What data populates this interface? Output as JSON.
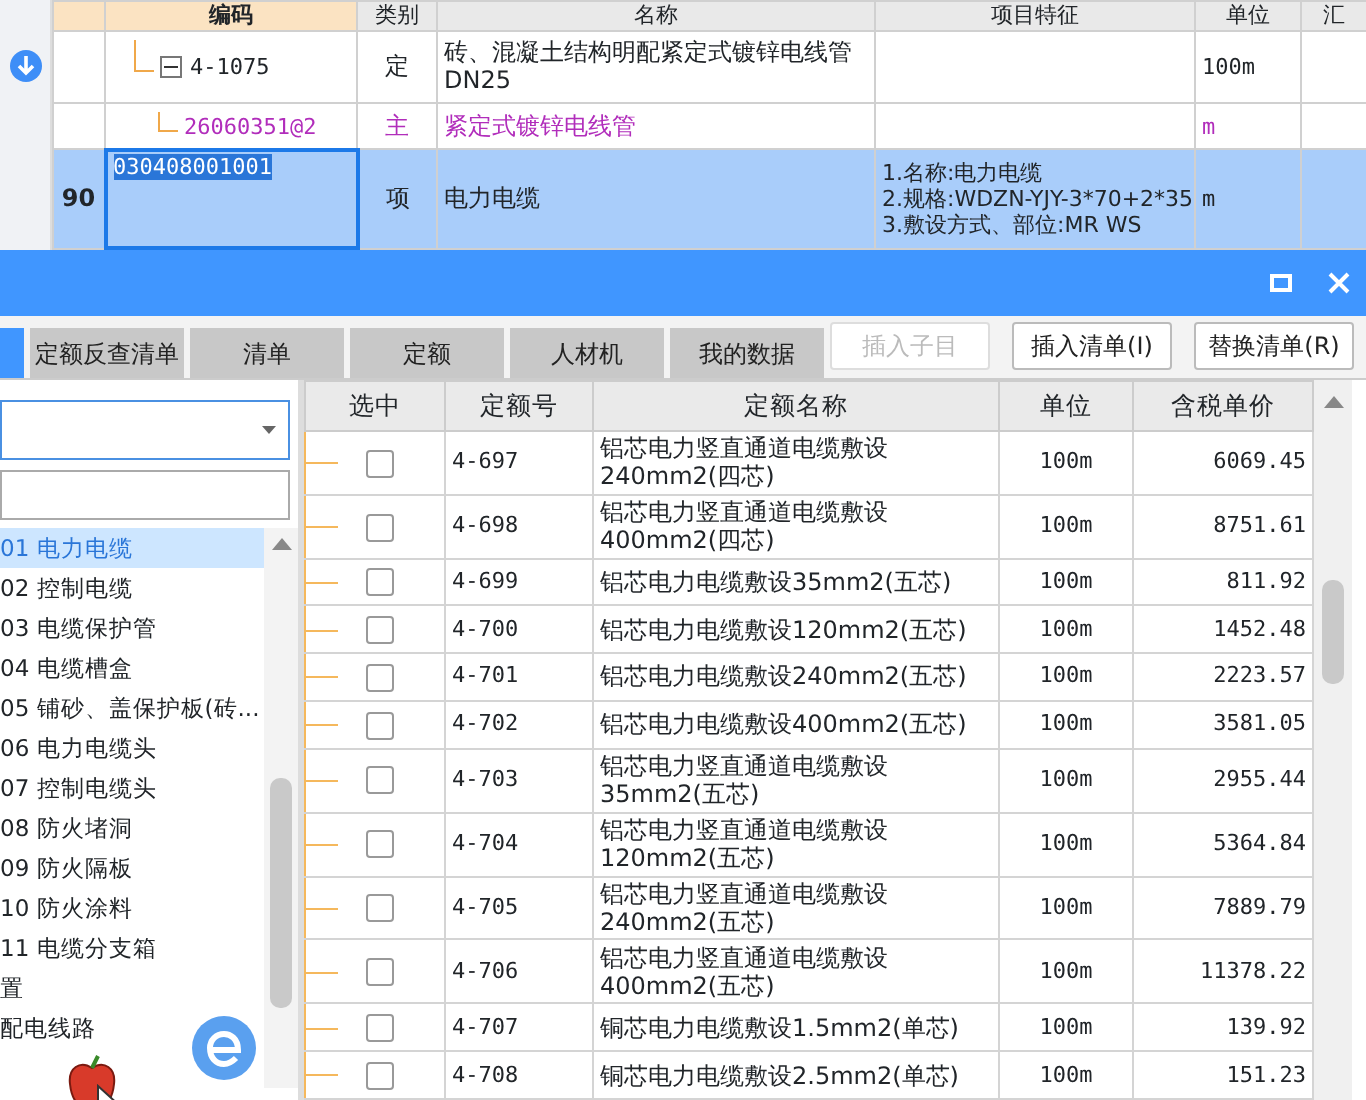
{
  "grid": {
    "columns": [
      "编码",
      "类别",
      "名称",
      "项目特征",
      "单位",
      "汇"
    ],
    "rows": [
      {
        "kind": "quota",
        "code": "4-1075",
        "expanded": true,
        "type": "定",
        "name": "砖、混凝土结构明配紧定式镀锌电线管DN25",
        "unit": "100m",
        "selected": false
      },
      {
        "kind": "material",
        "code": "26060351@2",
        "type": "主",
        "name": "紧定式镀锌电线管",
        "unit": "m",
        "selected": false
      },
      {
        "kind": "item",
        "number": "90",
        "code": "030408001001",
        "type": "项",
        "name": "电力电缆",
        "features": [
          "1.名称:电力电缆",
          "2.规格:WDZN-YJY-3*70+2*35",
          "3.敷设方式、部位:MR WS"
        ],
        "unit": "m",
        "selected": true
      }
    ]
  },
  "dialog": {
    "offscreen_tab": {
      "selected": true
    },
    "tabs": [
      {
        "label": "定额反查清单",
        "selected": false
      },
      {
        "label": "清单",
        "selected": false
      },
      {
        "label": "定额",
        "selected": false
      },
      {
        "label": "人材机",
        "selected": false
      },
      {
        "label": "我的数据",
        "selected": false
      }
    ],
    "buttons": [
      {
        "label": "插入子目",
        "disabled": true
      },
      {
        "label": "插入清单(I)",
        "disabled": false
      },
      {
        "label": "替换清单(R)",
        "disabled": false
      }
    ],
    "chapters": [
      {
        "code": "01",
        "name": "电力电缆",
        "selected": true
      },
      {
        "code": "02",
        "name": "控制电缆",
        "selected": false
      },
      {
        "code": "03",
        "name": "电缆保护管",
        "selected": false
      },
      {
        "code": "04",
        "name": "电缆槽盒",
        "selected": false
      },
      {
        "code": "05",
        "name": "铺砂、盖保护板(砖...",
        "selected": false
      },
      {
        "code": "06",
        "name": "电力电缆头",
        "selected": false
      },
      {
        "code": "07",
        "name": "控制电缆头",
        "selected": false
      },
      {
        "code": "08",
        "name": "防火堵洞",
        "selected": false
      },
      {
        "code": "09",
        "name": "防火隔板",
        "selected": false
      },
      {
        "code": "10",
        "name": "防火涂料",
        "selected": false
      },
      {
        "code": "11",
        "name": "电缆分支箱",
        "selected": false
      },
      {
        "name": "置",
        "selected": false
      },
      {
        "name": "配电线路",
        "selected": false
      }
    ],
    "quota_table": {
      "columns": [
        "选中",
        "定额号",
        "定额名称",
        "单位",
        "含税单价"
      ],
      "rows": [
        {
          "checked": false,
          "code": "4-697",
          "name": "铝芯电力竖直通道电缆敷设240mm2(四芯)",
          "unit": "100m",
          "price": "6069.45"
        },
        {
          "checked": false,
          "code": "4-698",
          "name": "铝芯电力竖直通道电缆敷设400mm2(四芯)",
          "unit": "100m",
          "price": "8751.61"
        },
        {
          "checked": false,
          "code": "4-699",
          "name": "铝芯电力电缆敷设35mm2(五芯)",
          "unit": "100m",
          "price": "811.92"
        },
        {
          "checked": false,
          "code": "4-700",
          "name": "铝芯电力电缆敷设120mm2(五芯)",
          "unit": "100m",
          "price": "1452.48"
        },
        {
          "checked": false,
          "code": "4-701",
          "name": "铝芯电力电缆敷设240mm2(五芯)",
          "unit": "100m",
          "price": "2223.57"
        },
        {
          "checked": false,
          "code": "4-702",
          "name": "铝芯电力电缆敷设400mm2(五芯)",
          "unit": "100m",
          "price": "3581.05"
        },
        {
          "checked": false,
          "code": "4-703",
          "name": "铝芯电力竖直通道电缆敷设35mm2(五芯)",
          "unit": "100m",
          "price": "2955.44"
        },
        {
          "checked": false,
          "code": "4-704",
          "name": "铝芯电力竖直通道电缆敷设120mm2(五芯)",
          "unit": "100m",
          "price": "5364.84"
        },
        {
          "checked": false,
          "code": "4-705",
          "name": "铝芯电力竖直通道电缆敷设240mm2(五芯)",
          "unit": "100m",
          "price": "7889.79"
        },
        {
          "checked": false,
          "code": "4-706",
          "name": "铝芯电力竖直通道电缆敷设400mm2(五芯)",
          "unit": "100m",
          "price": "11378.22"
        },
        {
          "checked": false,
          "code": "4-707",
          "name": "铜芯电力电缆敷设1.5mm2(单芯)",
          "unit": "100m",
          "price": "139.92"
        },
        {
          "checked": false,
          "code": "4-708",
          "name": "铜芯电力电缆敷设2.5mm2(单芯)",
          "unit": "100m",
          "price": "151.23"
        }
      ]
    }
  }
}
